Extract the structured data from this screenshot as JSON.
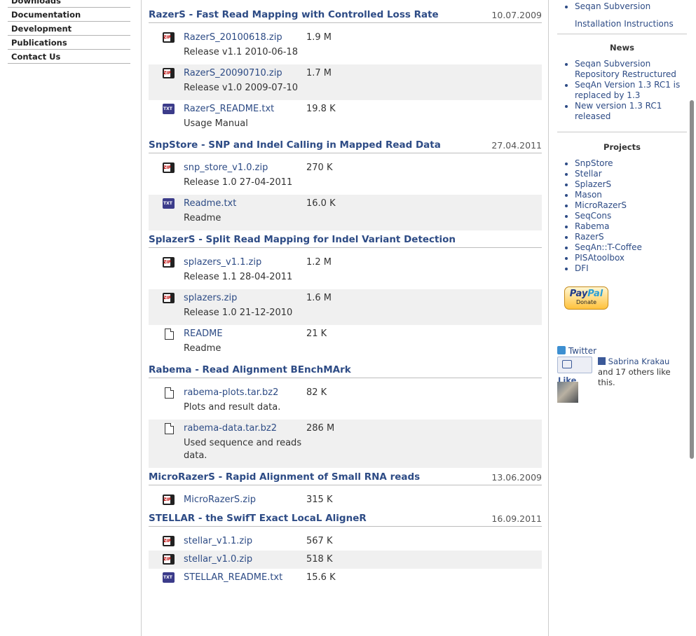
{
  "left_nav": [
    "Downloads",
    "Documentation",
    "Development",
    "Publications",
    "Contact Us"
  ],
  "projects": [
    {
      "title": "RazerS - Fast Read Mapping with Controlled Loss Rate",
      "date": "10.07.2009",
      "files": [
        {
          "icon": "zip-icon",
          "name": "RazerS_20100618.zip",
          "size": "1.9 M",
          "desc": "Release v1.1 2010-06-18"
        },
        {
          "icon": "zip-icon",
          "name": "RazerS_20090710.zip",
          "size": "1.7 M",
          "desc": "Release v1.0 2009-07-10"
        },
        {
          "icon": "txt-icon",
          "name": "RazerS_README.txt",
          "size": "19.8 K",
          "desc": "Usage Manual"
        }
      ]
    },
    {
      "title": "SnpStore - SNP and Indel Calling in Mapped Read Data",
      "date": "27.04.2011",
      "files": [
        {
          "icon": "zip-icon",
          "name": "snp_store_v1.0.zip",
          "size": "270 K",
          "desc": "Release 1.0 27-04-2011"
        },
        {
          "icon": "txt-icon",
          "name": "Readme.txt",
          "size": "16.0 K",
          "desc": "Readme"
        }
      ]
    },
    {
      "title": "SplazerS - Split Read Mapping for Indel Variant Detection",
      "date": "",
      "files": [
        {
          "icon": "zip-icon",
          "name": "splazers_v1.1.zip",
          "size": "1.2 M",
          "desc": "Release 1.1 28-04-2011"
        },
        {
          "icon": "zip-icon",
          "name": "splazers.zip",
          "size": "1.6 M",
          "desc": "Release 1.0 21-12-2010"
        },
        {
          "icon": "document-icon",
          "name": "README",
          "size": "21 K",
          "desc": "Readme"
        }
      ]
    },
    {
      "title": "Rabema - Read Alignment BEnchMArk",
      "date": "",
      "files": [
        {
          "icon": "document-icon",
          "name": "rabema-plots.tar.bz2",
          "size": "82 K",
          "desc": "Plots and result data."
        },
        {
          "icon": "document-icon",
          "name": "rabema-data.tar.bz2",
          "size": "286 M",
          "desc": "Used sequence and reads data."
        }
      ]
    },
    {
      "title": "MicroRazerS - Rapid Alignment of Small RNA reads",
      "date": "13.06.2009",
      "files": [
        {
          "icon": "zip-icon",
          "name": "MicroRazerS.zip",
          "size": "315 K",
          "desc": ""
        }
      ]
    },
    {
      "title": "STELLAR - the SwifT Exact LocaL AligneR",
      "date": "16.09.2011",
      "files": [
        {
          "icon": "zip-icon",
          "name": "stellar_v1.1.zip",
          "size": "567 K",
          "desc": ""
        },
        {
          "icon": "zip-icon",
          "name": "stellar_v1.0.zip",
          "size": "518 K",
          "desc": ""
        },
        {
          "icon": "txt-icon",
          "name": "STELLAR_README.txt",
          "size": "15.6 K",
          "desc": ""
        }
      ]
    }
  ],
  "sidebar": {
    "top_links": [
      "Seqan Subversion",
      "Installation Instructions"
    ],
    "news_title": "News",
    "news": [
      "Seqan Subversion Repository Restructured",
      "SeqAn Version 1.3 RC1 is replaced by 1.3",
      "New version 1.3 RC1 released"
    ],
    "projects_title": "Projects",
    "projects": [
      "SnpStore",
      "Stellar",
      "SplazerS",
      "Mason",
      "MicroRazerS",
      "SeqCons",
      "Rabema",
      "RazerS",
      "SeqAn::T-Coffee",
      "PISAtoolbox",
      "DFI"
    ],
    "paypal": {
      "brand_a": "Pay",
      "brand_b": "Pal",
      "label": "Donate"
    },
    "twitter_label": "Twitter",
    "like_label": "Like",
    "like_name": "Sabrina Krakau",
    "like_text": " and 17 others like this."
  },
  "colors": {
    "link": "#2d4b85",
    "row_alt": "#f0f0f0"
  }
}
